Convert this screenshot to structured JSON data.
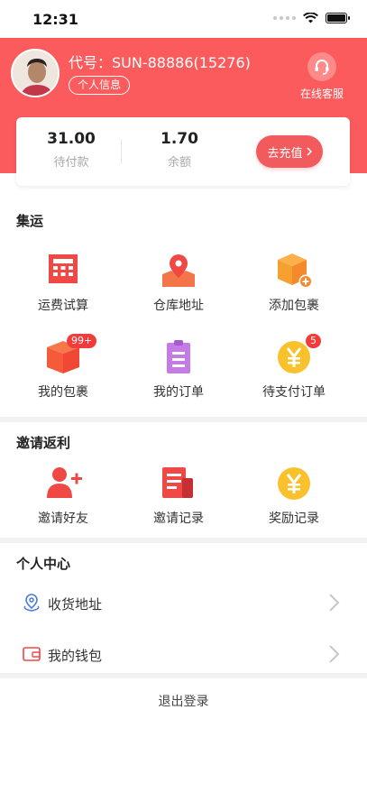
{
  "status_bar": {
    "time": "12:31"
  },
  "header": {
    "user_code": "代号：SUN-88886(15276)",
    "profile_button": "个人信息",
    "service_label": "在线客服"
  },
  "wallet": {
    "pending": {
      "value": "31.00",
      "label": "待付款"
    },
    "balance": {
      "value": "1.70",
      "label": "余额"
    },
    "recharge_button": "去充值"
  },
  "shipping": {
    "title": "集运",
    "items": [
      {
        "label": "运费试算",
        "icon": "calculator-icon"
      },
      {
        "label": "仓库地址",
        "icon": "location-icon"
      },
      {
        "label": "添加包裹",
        "icon": "add-package-icon"
      },
      {
        "label": "我的包裹",
        "icon": "package-icon",
        "badge": "99+"
      },
      {
        "label": "我的订单",
        "icon": "order-icon"
      },
      {
        "label": "待支付订单",
        "icon": "yen-coin-icon",
        "badge": "5"
      }
    ]
  },
  "invite": {
    "title": "邀请返利",
    "items": [
      {
        "label": "邀请好友",
        "icon": "add-user-icon"
      },
      {
        "label": "邀请记录",
        "icon": "record-icon"
      },
      {
        "label": "奖励记录",
        "icon": "reward-coin-icon"
      }
    ]
  },
  "personal": {
    "title": "个人中心",
    "rows": [
      {
        "label": "收货地址",
        "icon": "address-pin-icon"
      },
      {
        "label": "我的钱包",
        "icon": "wallet-icon"
      }
    ],
    "logout": "退出登录"
  },
  "colors": {
    "brand_red": "#fb5b5c",
    "orange": "#f58a2c",
    "purple": "#c47be6",
    "yellow": "#f9c12c",
    "badge_red": "#f33b3b"
  }
}
